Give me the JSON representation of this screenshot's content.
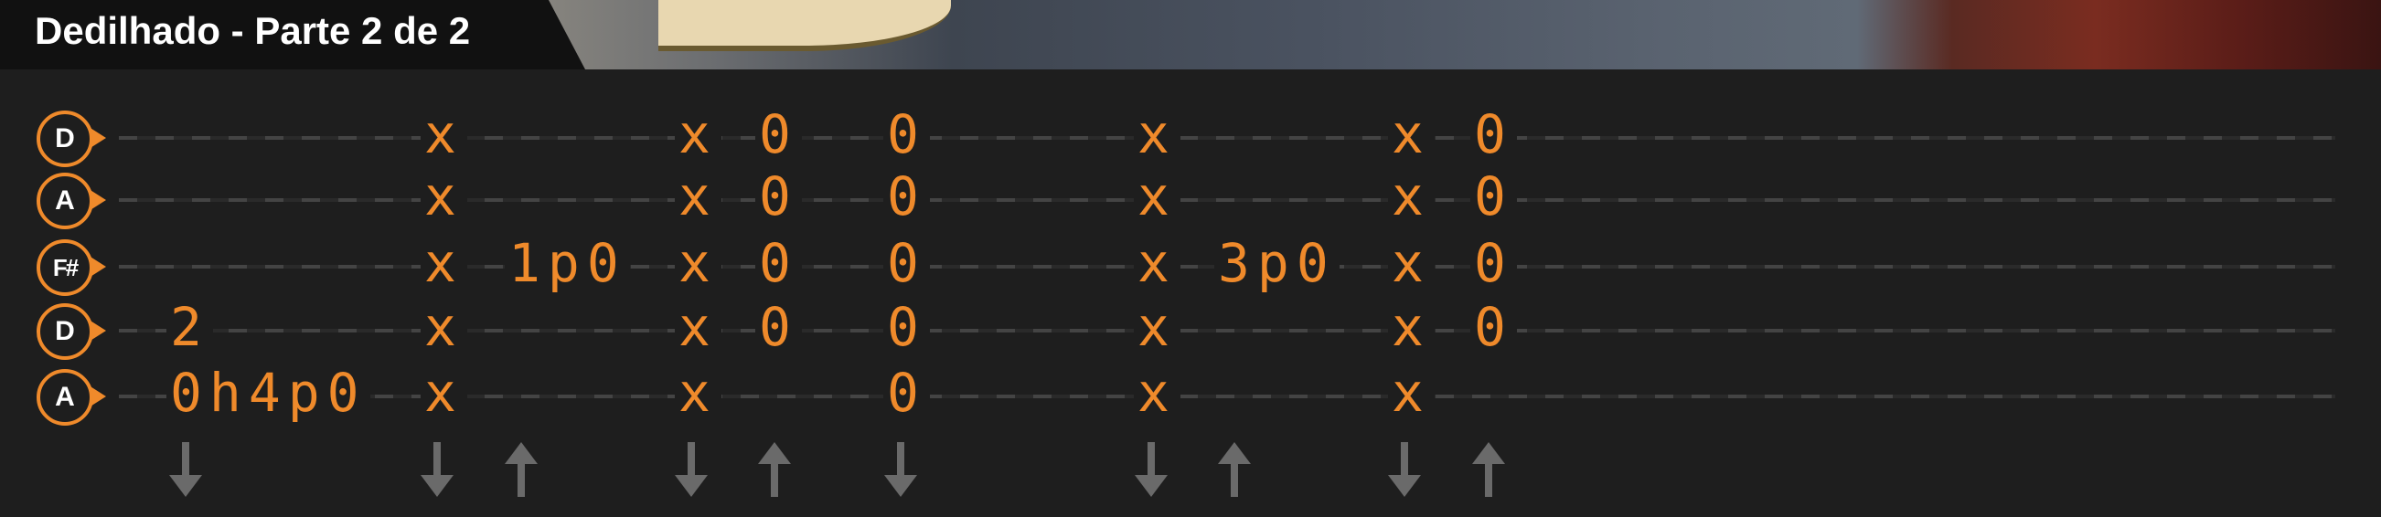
{
  "header": {
    "title": "Dedilhado - Parte 2 de 2"
  },
  "colors": {
    "note": "#ef8a2b",
    "badge_ring": "#ef8a2b",
    "arrow": "#6a6a6a",
    "background": "#1e1e1e"
  },
  "strings": [
    {
      "label": "D"
    },
    {
      "label": "A"
    },
    {
      "label": "F#"
    },
    {
      "label": "D"
    },
    {
      "label": "A"
    }
  ],
  "columns": [
    {
      "notes": [
        "",
        "",
        "",
        "2",
        "0h4p0"
      ],
      "strum": "down"
    },
    {
      "notes": [
        "x",
        "x",
        "x",
        "x",
        "x"
      ],
      "strum": "down"
    },
    {
      "notes": [
        "",
        "",
        "1p0",
        "",
        ""
      ],
      "strum": "up"
    },
    {
      "notes": [
        "x",
        "x",
        "x",
        "x",
        "x"
      ],
      "strum": "down"
    },
    {
      "notes": [
        "0",
        "0",
        "0",
        "0",
        ""
      ],
      "strum": "up"
    },
    {
      "notes": [
        "0",
        "0",
        "0",
        "0",
        "0"
      ],
      "strum": "down"
    },
    {
      "notes": [
        "x",
        "x",
        "x",
        "x",
        "x"
      ],
      "strum": "down"
    },
    {
      "notes": [
        "",
        "",
        "3p0",
        "",
        ""
      ],
      "strum": "up"
    },
    {
      "notes": [
        "x",
        "x",
        "x",
        "x",
        "x"
      ],
      "strum": "down"
    },
    {
      "notes": [
        "0",
        "0",
        "0",
        "0",
        ""
      ],
      "strum": "up"
    }
  ]
}
